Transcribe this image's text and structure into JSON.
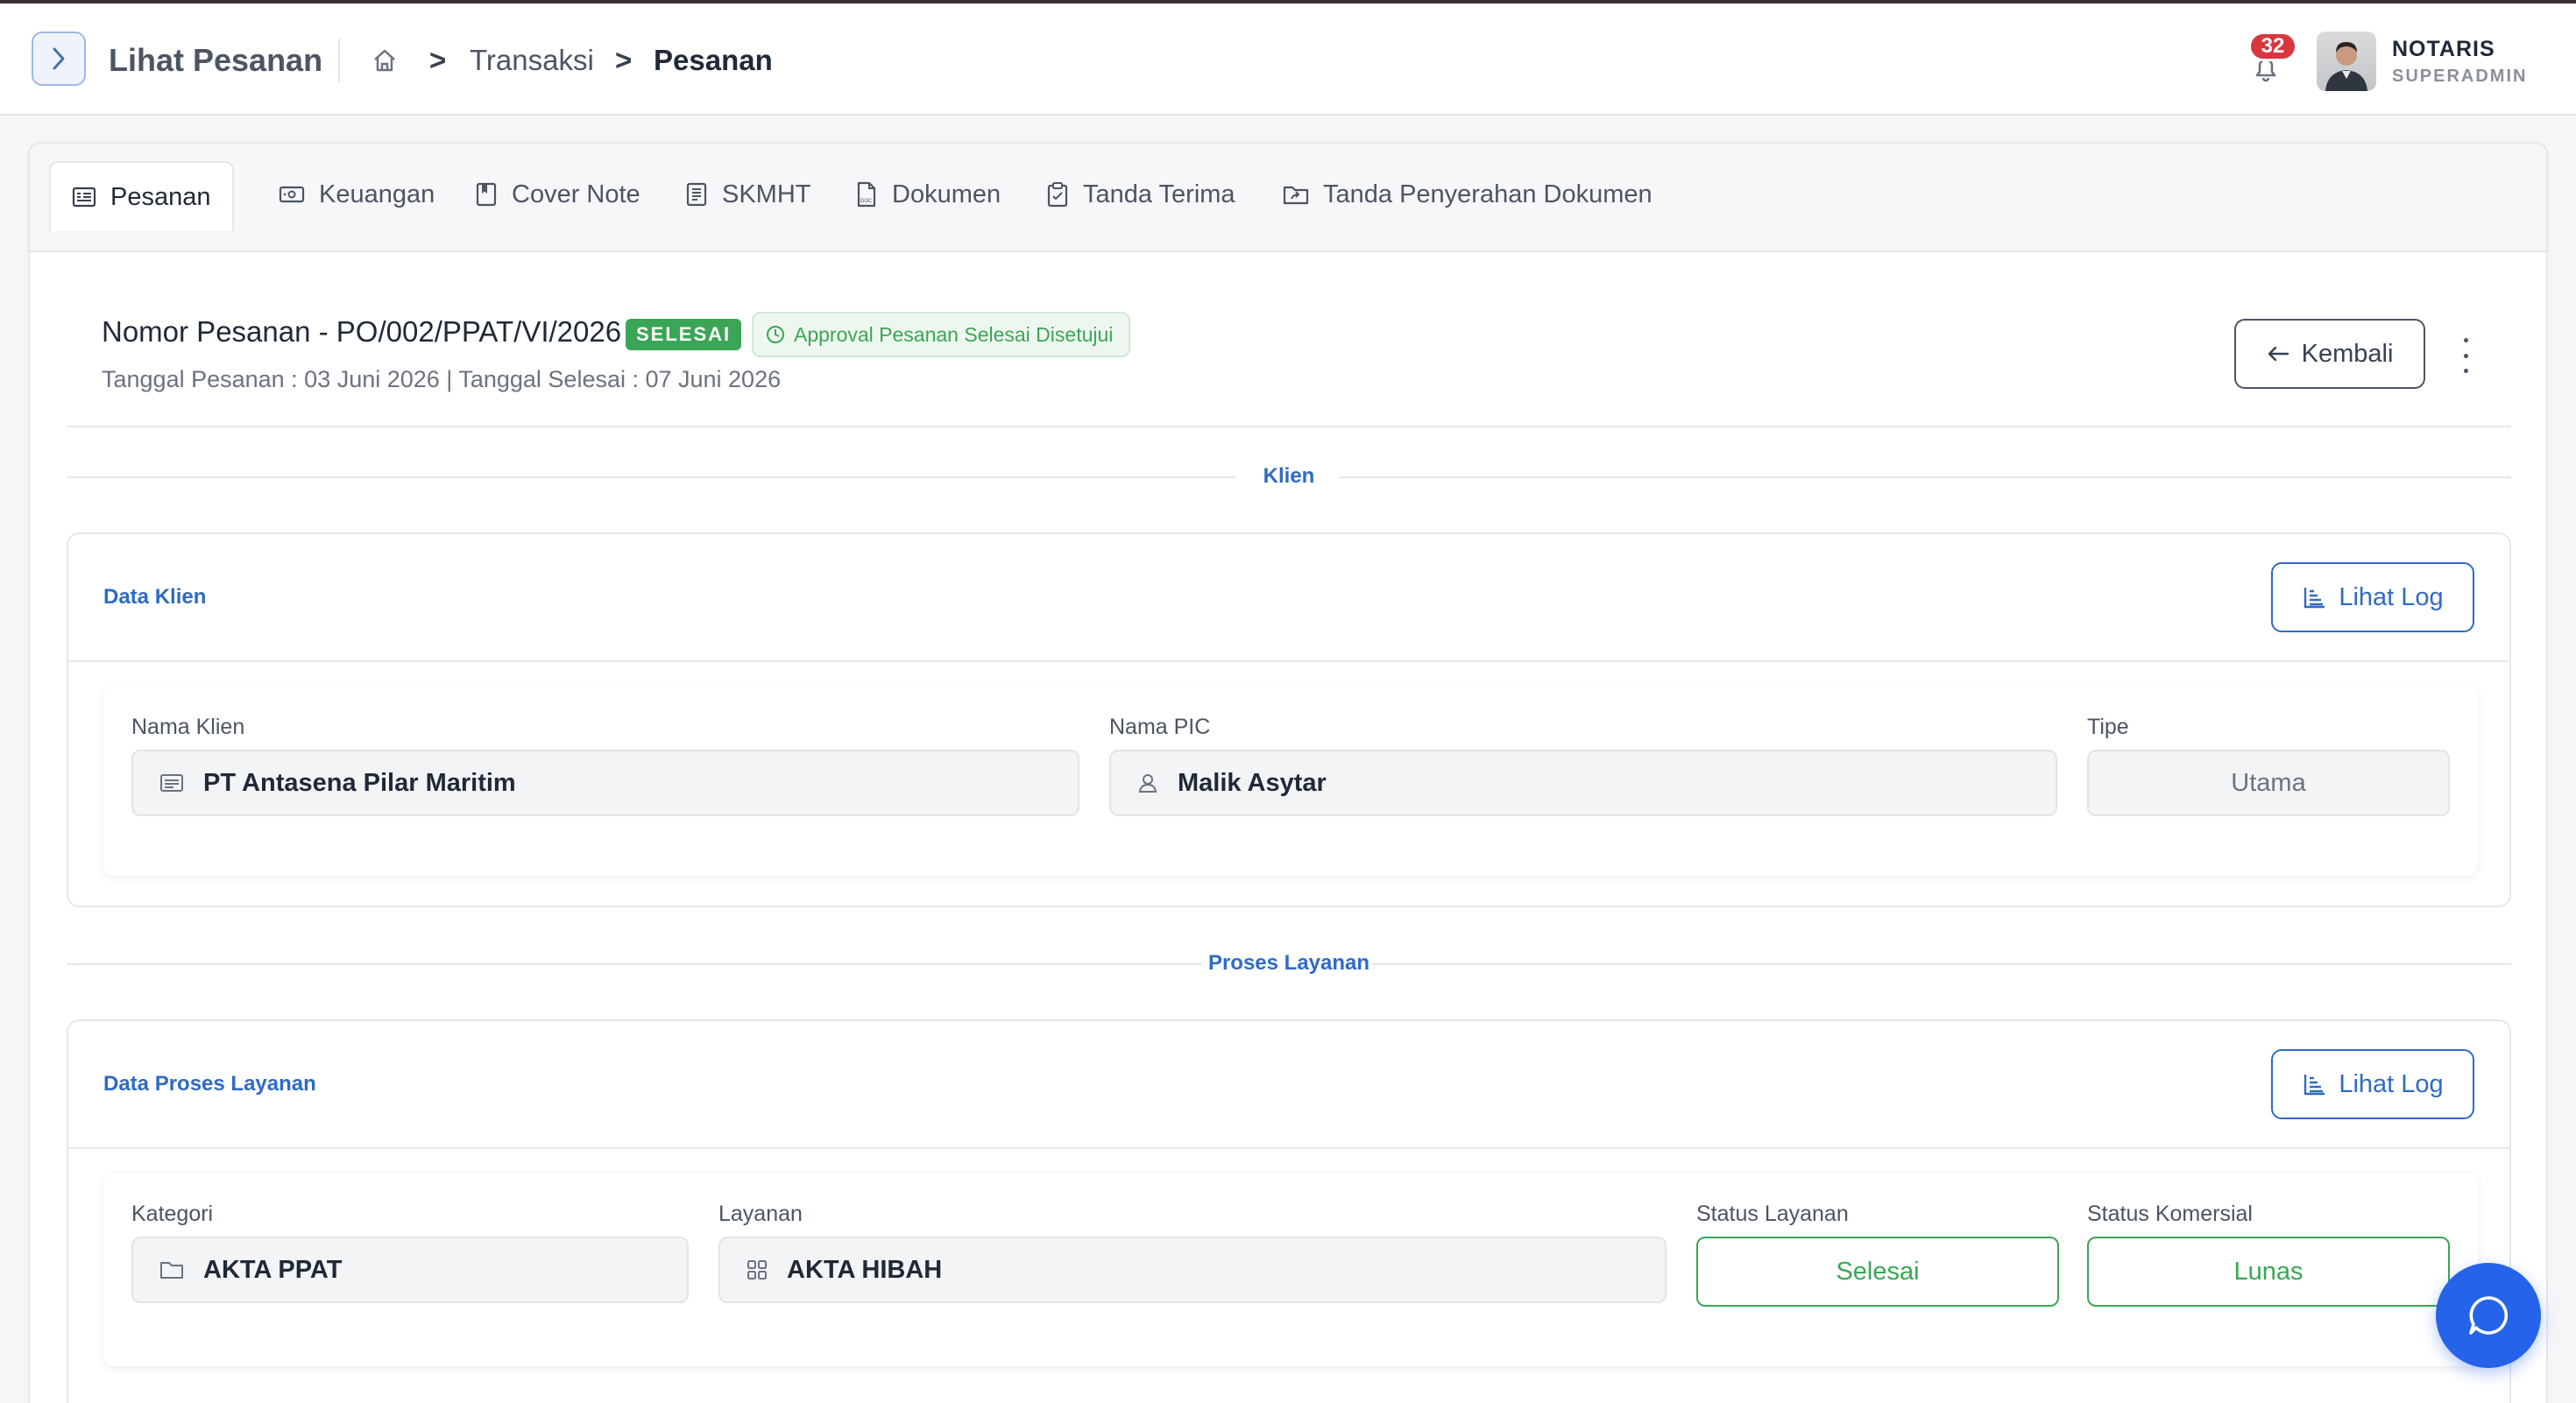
{
  "header": {
    "title": "Lihat Pesanan",
    "breadcrumb": [
      {
        "label": ">"
      },
      {
        "label": "Transaksi"
      },
      {
        "label": ">"
      },
      {
        "label": "Pesanan"
      }
    ],
    "notification_count": "32",
    "user": {
      "name": "NOTARIS",
      "role": "SUPERADMIN"
    }
  },
  "tabs": [
    {
      "label": "Pesanan",
      "icon": "order-list-icon",
      "active": true
    },
    {
      "label": "Keuangan",
      "icon": "money-icon"
    },
    {
      "label": "Cover Note",
      "icon": "bookmark-icon"
    },
    {
      "label": "SKMHT",
      "icon": "document-text-icon"
    },
    {
      "label": "Dokumen",
      "icon": "doc-file-icon"
    },
    {
      "label": "Tanda Terima",
      "icon": "clipboard-icon"
    },
    {
      "label": "Tanda Penyerahan Dokumen",
      "icon": "folder-share-icon"
    }
  ],
  "order": {
    "title": "Nomor Pesanan - PO/002/PPAT/VI/2026",
    "status_badge": "SELESAI",
    "approval": "Approval Pesanan Selesai Disetujui",
    "dates": "Tanggal Pesanan : 03 Juni 2026 | Tanggal Selesai : 07 Juni 2026",
    "back_label": "Kembali"
  },
  "client_section": {
    "divider_label": "Klien",
    "panel_title": "Data Klien",
    "log_label": "Lihat Log",
    "fields": {
      "client_name_label": "Nama Klien",
      "client_name": "PT Antasena Pilar Maritim",
      "pic_label": "Nama PIC",
      "pic": "Malik Asytar",
      "type_label": "Tipe",
      "type": "Utama"
    }
  },
  "service_section": {
    "divider_label": "Proses Layanan",
    "panel_title": "Data Proses Layanan",
    "log_label": "Lihat Log",
    "fields": {
      "category_label": "Kategori",
      "category": "AKTA PPAT",
      "service_label": "Layanan",
      "service": "AKTA HIBAH",
      "service_status_label": "Status Layanan",
      "service_status": "Selesai",
      "commercial_status_label": "Status Komersial",
      "commercial_status": "Lunas"
    }
  },
  "colors": {
    "accent": "#2f6bc4",
    "success": "#3aa655",
    "danger": "#d9363e",
    "fab": "#2563eb"
  }
}
